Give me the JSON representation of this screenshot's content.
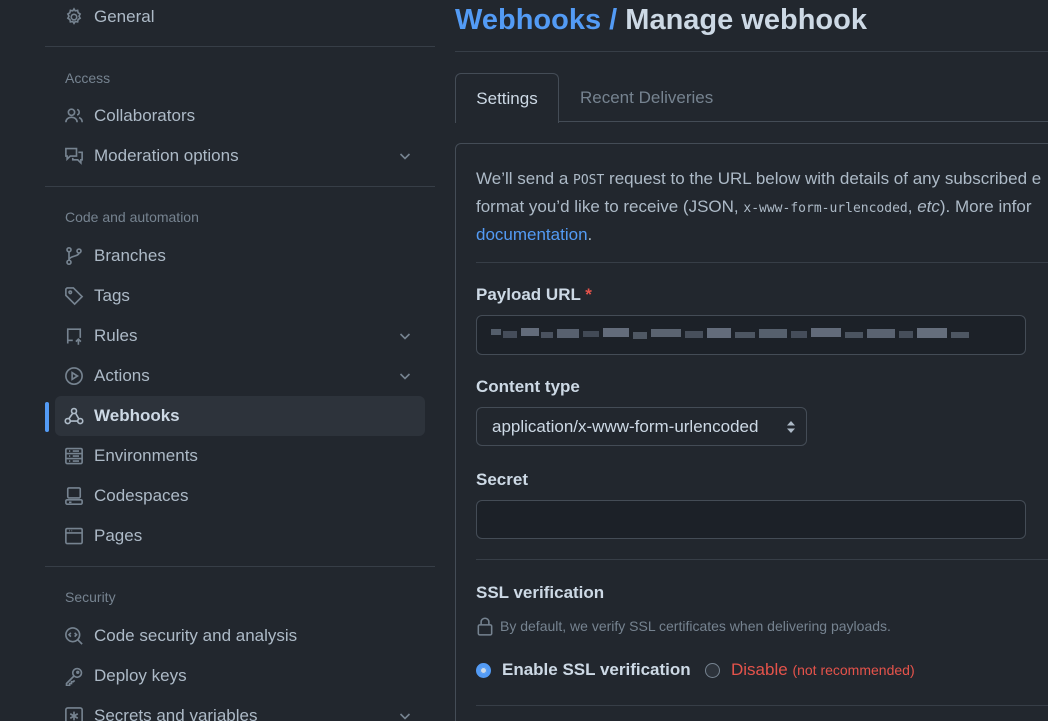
{
  "sidebar": {
    "general": "General",
    "sections": {
      "access": "Access",
      "code_automation": "Code and automation",
      "security": "Security"
    },
    "access_items": [
      {
        "label": "Collaborators",
        "icon": "people-icon"
      },
      {
        "label": "Moderation options",
        "icon": "comment-discussion-icon",
        "expandable": true
      }
    ],
    "code_items": [
      {
        "label": "Branches",
        "icon": "git-branch-icon"
      },
      {
        "label": "Tags",
        "icon": "tag-icon"
      },
      {
        "label": "Rules",
        "icon": "repo-push-icon",
        "expandable": true
      },
      {
        "label": "Actions",
        "icon": "play-icon",
        "expandable": true
      },
      {
        "label": "Webhooks",
        "icon": "webhook-icon",
        "active": true
      },
      {
        "label": "Environments",
        "icon": "server-icon"
      },
      {
        "label": "Codespaces",
        "icon": "codespaces-icon"
      },
      {
        "label": "Pages",
        "icon": "browser-icon"
      }
    ],
    "security_items": [
      {
        "label": "Code security and analysis",
        "icon": "codescan-icon"
      },
      {
        "label": "Deploy keys",
        "icon": "key-icon"
      },
      {
        "label": "Secrets and variables",
        "icon": "key-asterisk-icon",
        "expandable": true
      }
    ]
  },
  "header": {
    "breadcrumb": "Webhooks",
    "separator": "/",
    "title": "Manage webhook"
  },
  "tabs": {
    "settings": "Settings",
    "recent": "Recent Deliveries"
  },
  "intro": {
    "part1": "We’ll send a ",
    "post": "POST",
    "part2": " request to the URL below with details of any subscribed e",
    "line2_a": "format you’d like to receive (JSON, ",
    "line2_code": "x-www-form-urlencoded",
    "line2_b": ", ",
    "line2_etc": "etc",
    "line2_c": "). More infor",
    "link": "documentation",
    "link_end": "."
  },
  "form": {
    "payload_label": "Payload URL",
    "required_mark": "*",
    "content_type_label": "Content type",
    "content_type_value": "application/x-www-form-urlencoded",
    "secret_label": "Secret",
    "ssl_label": "SSL verification",
    "ssl_note": "By default, we verify SSL certificates when delivering payloads.",
    "enable_ssl": "Enable SSL verification",
    "disable_ssl": "Disable",
    "not_recommended": "(not recommended)"
  },
  "colors": {
    "accent": "#539bf5",
    "danger": "#e5534b",
    "background": "#22272e"
  }
}
